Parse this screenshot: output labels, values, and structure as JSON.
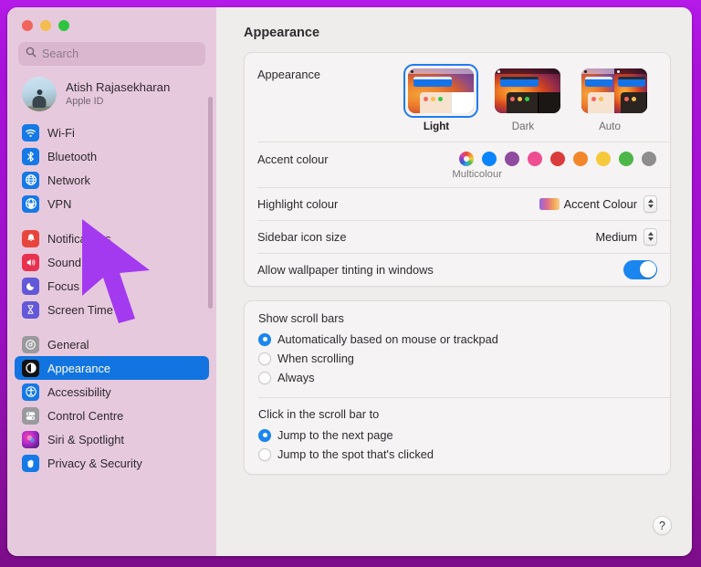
{
  "window": {
    "traffic_lights": [
      "close",
      "minimise",
      "zoom"
    ],
    "border_colour": "#a812d8"
  },
  "sidebar": {
    "search": {
      "placeholder": "Search",
      "icon": "search-icon",
      "value": ""
    },
    "account": {
      "name": "Atish Rajasekharan",
      "subtitle": "Apple ID",
      "avatar": "user-avatar"
    },
    "groups": [
      {
        "items": [
          {
            "label": "Wi-Fi",
            "icon": "wifi-icon",
            "selected": false
          },
          {
            "label": "Bluetooth",
            "icon": "bluetooth-icon",
            "selected": false
          },
          {
            "label": "Network",
            "icon": "network-globe-icon",
            "selected": false
          },
          {
            "label": "VPN",
            "icon": "vpn-globe-icon",
            "selected": false
          }
        ]
      },
      {
        "items": [
          {
            "label": "Notifications",
            "icon": "notifications-bell-icon",
            "selected": false
          },
          {
            "label": "Sound",
            "icon": "sound-speaker-icon",
            "selected": false
          },
          {
            "label": "Focus",
            "icon": "focus-moon-icon",
            "selected": false
          },
          {
            "label": "Screen Time",
            "icon": "screen-time-hourglass-icon",
            "selected": false
          }
        ]
      },
      {
        "items": [
          {
            "label": "General",
            "icon": "general-gear-icon",
            "selected": false
          },
          {
            "label": "Appearance",
            "icon": "appearance-icon",
            "selected": true
          },
          {
            "label": "Accessibility",
            "icon": "accessibility-icon",
            "selected": false
          },
          {
            "label": "Control Centre",
            "icon": "control-centre-icon",
            "selected": false
          },
          {
            "label": "Siri & Spotlight",
            "icon": "siri-icon",
            "selected": false
          },
          {
            "label": "Privacy & Security",
            "icon": "privacy-hand-icon",
            "selected": false
          }
        ]
      }
    ],
    "selected_accent": "#1274e0"
  },
  "main": {
    "title": "Appearance",
    "appearance": {
      "label": "Appearance",
      "options": [
        {
          "caption": "Light",
          "selected": true
        },
        {
          "caption": "Dark",
          "selected": false
        },
        {
          "caption": "Auto",
          "selected": false
        }
      ]
    },
    "accent": {
      "label": "Accent colour",
      "caption": "Multicolour",
      "swatches": [
        {
          "name": "multicolour",
          "colour": "multi",
          "selected": true
        },
        {
          "name": "blue",
          "colour": "#0a84ff"
        },
        {
          "name": "purple",
          "colour": "#8e4ba0"
        },
        {
          "name": "pink",
          "colour": "#ef4d92"
        },
        {
          "name": "red",
          "colour": "#da3b3b"
        },
        {
          "name": "orange",
          "colour": "#f2862a"
        },
        {
          "name": "yellow",
          "colour": "#f5c93b"
        },
        {
          "name": "green",
          "colour": "#4cb648"
        },
        {
          "name": "graphite",
          "colour": "#8e8e8e"
        }
      ]
    },
    "highlight": {
      "label": "Highlight colour",
      "value": "Accent Colour"
    },
    "sidebar_icon_size": {
      "label": "Sidebar icon size",
      "value": "Medium"
    },
    "wallpaper_tinting": {
      "label": "Allow wallpaper tinting in windows",
      "enabled": true
    },
    "show_scroll_bars": {
      "title": "Show scroll bars",
      "options": [
        {
          "label": "Automatically based on mouse or trackpad",
          "selected": true
        },
        {
          "label": "When scrolling",
          "selected": false
        },
        {
          "label": "Always",
          "selected": false
        }
      ]
    },
    "click_scroll_bar": {
      "title": "Click in the scroll bar to",
      "options": [
        {
          "label": "Jump to the next page",
          "selected": true
        },
        {
          "label": "Jump to the spot that's clicked",
          "selected": false
        }
      ]
    },
    "help_button": {
      "label": "?"
    }
  },
  "annotation": {
    "cursor": "purple-arrow-pointer",
    "colour": "#a33af0"
  }
}
